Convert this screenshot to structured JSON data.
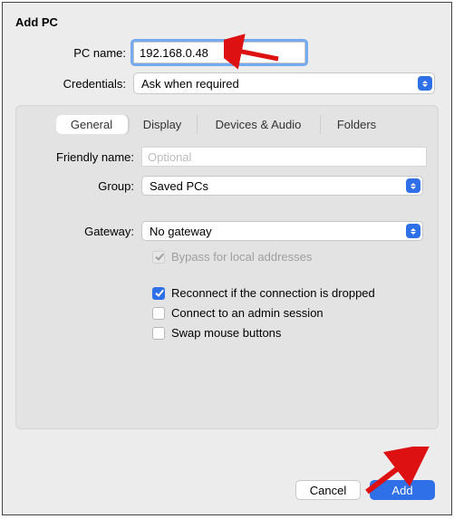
{
  "dialog": {
    "title": "Add PC",
    "pc_name_label": "PC name:",
    "pc_name_value": "192.168.0.48",
    "credentials_label": "Credentials:",
    "credentials_value": "Ask when required"
  },
  "tabs": {
    "general": "General",
    "display": "Display",
    "devices": "Devices & Audio",
    "folders": "Folders"
  },
  "general": {
    "friendly_label": "Friendly name:",
    "friendly_placeholder": "Optional",
    "group_label": "Group:",
    "group_value": "Saved PCs",
    "gateway_label": "Gateway:",
    "gateway_value": "No gateway",
    "bypass_label": "Bypass for local addresses",
    "reconnect_label": "Reconnect if the connection is dropped",
    "admin_label": "Connect to an admin session",
    "swap_label": "Swap mouse buttons"
  },
  "footer": {
    "cancel": "Cancel",
    "add": "Add"
  }
}
